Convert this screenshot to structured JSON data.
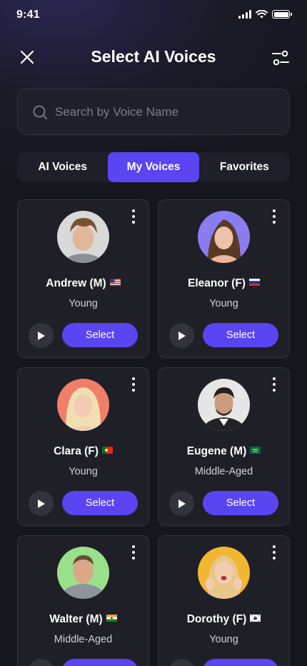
{
  "status_bar": {
    "time": "9:41"
  },
  "header": {
    "title": "Select AI Voices"
  },
  "search": {
    "placeholder": "Search by Voice Name",
    "value": ""
  },
  "tabs": [
    {
      "label": "AI Voices",
      "active": false
    },
    {
      "label": "My Voices",
      "active": true
    },
    {
      "label": "Favorites",
      "active": false
    }
  ],
  "voices": [
    {
      "name": "Andrew (M)",
      "flag": "united-states-flag",
      "age": "Young",
      "select_label": "Select",
      "avatar_bg": "#d9d9d9"
    },
    {
      "name": "Eleanor (F)",
      "flag": "russia-flag",
      "age": "Young",
      "select_label": "Select",
      "avatar_bg": "#8a7df2"
    },
    {
      "name": "Clara (F)",
      "flag": "portugal-flag",
      "age": "Young",
      "select_label": "Select",
      "avatar_bg": "#f07f6a"
    },
    {
      "name": "Eugene (M)",
      "flag": "saudi-arabia-flag",
      "age": "Middle-Aged",
      "select_label": "Select",
      "avatar_bg": "#e6e6e6"
    },
    {
      "name": "Walter (M)",
      "flag": "india-flag",
      "age": "Middle-Aged",
      "select_label": "Select",
      "avatar_bg": "#9ae08a"
    },
    {
      "name": "Dorothy (F)",
      "flag": "south-korea-flag",
      "age": "Young",
      "select_label": "Select",
      "avatar_bg": "#f2b632"
    }
  ],
  "colors": {
    "accent": "#5a45f2",
    "card_bg": "#1f1f28",
    "page_bg": "#16161f"
  }
}
